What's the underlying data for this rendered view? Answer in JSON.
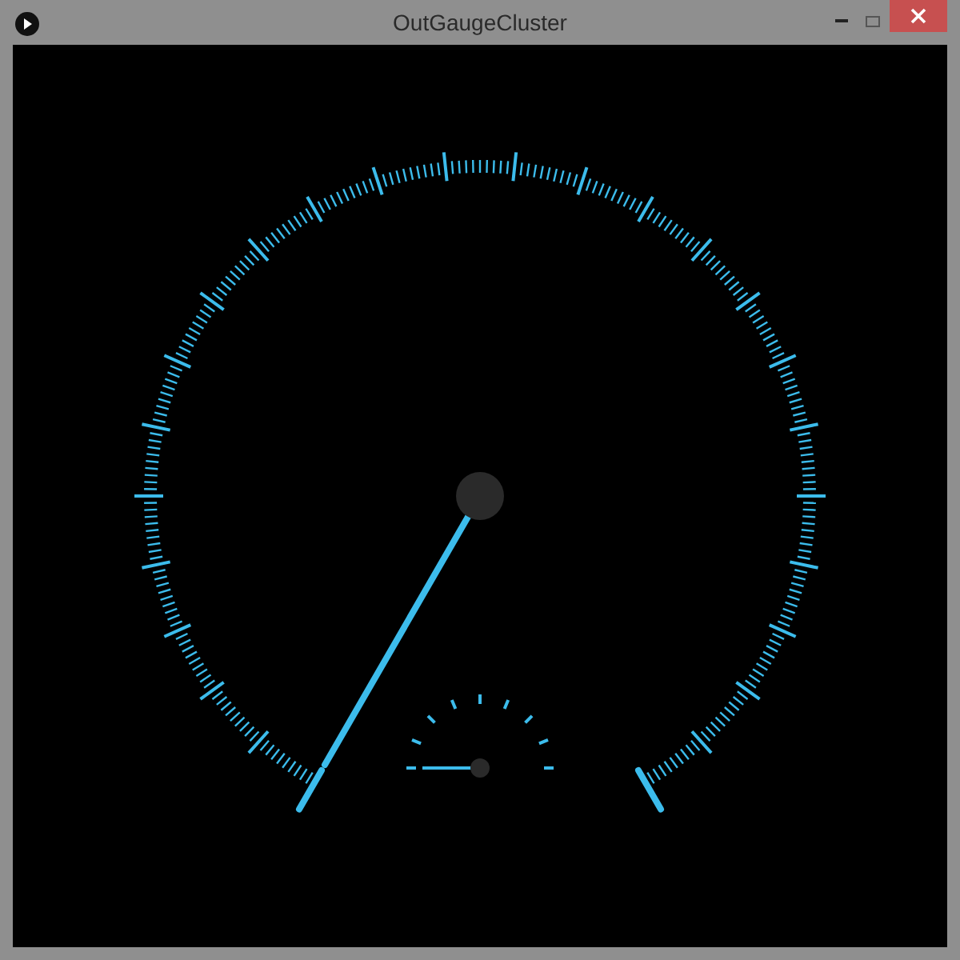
{
  "window": {
    "title": "OutGaugeCluster"
  }
}
